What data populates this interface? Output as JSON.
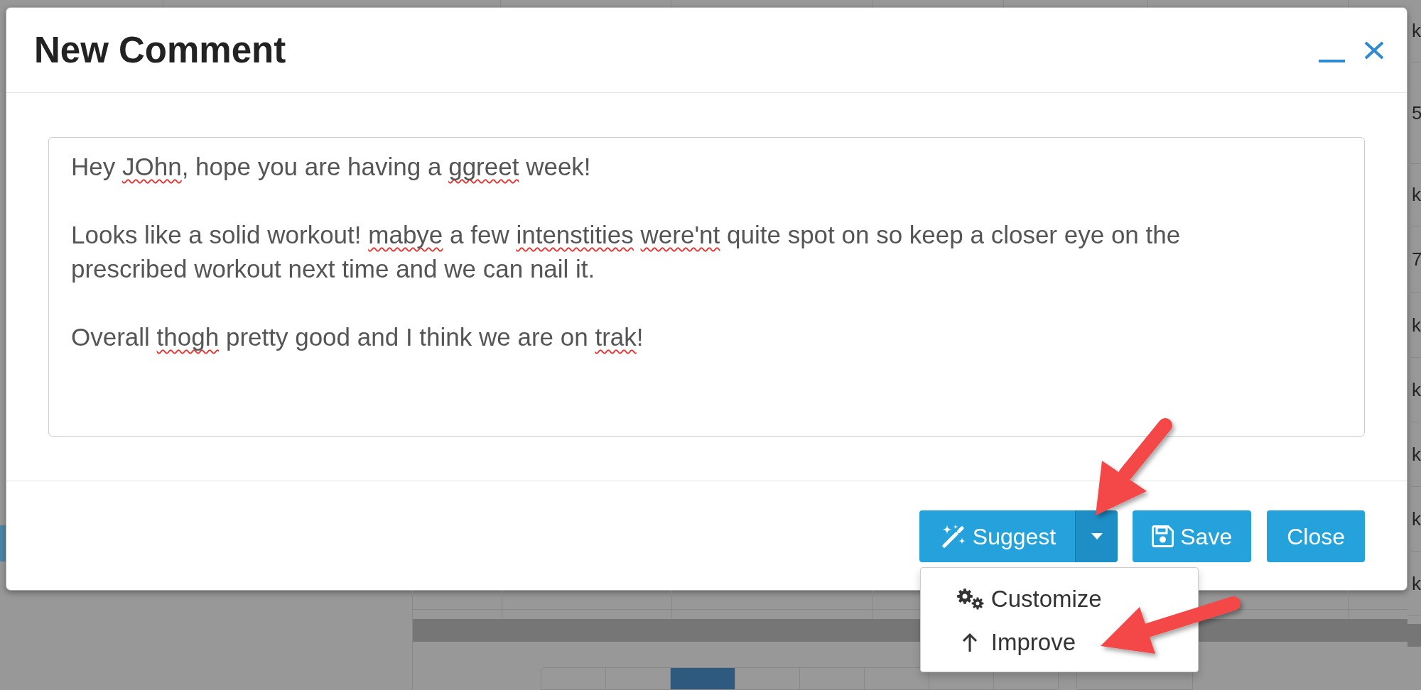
{
  "background": {
    "edge_cells": [
      "k",
      "5",
      "k",
      "7",
      "k",
      "k",
      "k",
      "k",
      "k"
    ],
    "pager": [
      {
        "selected": false
      },
      {
        "selected": false
      },
      {
        "selected": true
      },
      {
        "selected": false
      },
      {
        "selected": false
      },
      {
        "selected": false
      },
      {
        "selected": false
      },
      {
        "selected": false
      }
    ]
  },
  "dialog": {
    "title": "New Comment",
    "comment": {
      "paragraphs": [
        {
          "segments": [
            {
              "text": "Hey ",
              "misspelled": false
            },
            {
              "text": "JOhn",
              "misspelled": true
            },
            {
              "text": ", hope you are having a ",
              "misspelled": false
            },
            {
              "text": "ggreet",
              "misspelled": true
            },
            {
              "text": " week!",
              "misspelled": false
            }
          ]
        },
        {
          "segments": [
            {
              "text": "Looks like a solid workout! ",
              "misspelled": false
            },
            {
              "text": "mabye",
              "misspelled": true
            },
            {
              "text": " a few ",
              "misspelled": false
            },
            {
              "text": "intenstities ",
              "misspelled": true
            },
            {
              "text": "were'nt",
              "misspelled": true
            },
            {
              "text": " quite spot on so keep a closer eye on the prescribed workout next time and we can nail it.",
              "misspelled": false
            }
          ]
        },
        {
          "segments": [
            {
              "text": "Overall ",
              "misspelled": false
            },
            {
              "text": "thogh",
              "misspelled": true
            },
            {
              "text": " pretty good and I think we are on ",
              "misspelled": false
            },
            {
              "text": "trak",
              "misspelled": true
            },
            {
              "text": "!",
              "misspelled": false
            }
          ]
        }
      ]
    },
    "suggest": {
      "label": "Suggest",
      "expanded": true,
      "menu": [
        {
          "kind": "customize",
          "label": "Customize"
        },
        {
          "kind": "improve",
          "label": "Improve"
        }
      ]
    },
    "buttons": [
      {
        "kind": "save",
        "label": "Save"
      },
      {
        "kind": "close",
        "label": "Close"
      }
    ]
  }
}
